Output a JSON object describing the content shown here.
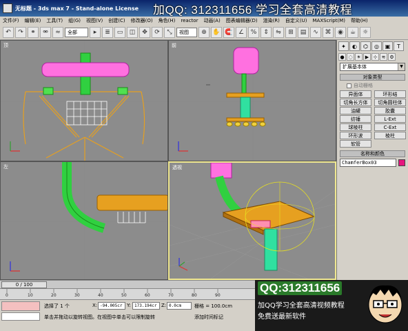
{
  "window": {
    "title": "无标题 - 3ds max 7 - Stand-alone License",
    "watermark": "加QQ: 312311656 学习全套高清教程"
  },
  "menu": [
    "文件(F)",
    "编辑(E)",
    "工具(T)",
    "组(G)",
    "视图(V)",
    "创建(C)",
    "修改器(O)",
    "角色(H)",
    "reactor",
    "动画(A)",
    "图表编辑器(D)",
    "渲染(R)",
    "自定义(U)",
    "MAXScript(M)",
    "帮助(H)"
  ],
  "toolbar": {
    "selection_filter": "全部",
    "ref_coord": "视图"
  },
  "viewports": {
    "top_left_label": "顶",
    "top_right_label": "前",
    "bottom_left_label": "左",
    "bottom_right_label": "透视"
  },
  "command_panel": {
    "category": "扩展基本体",
    "rollout_object_type": "对象类型",
    "autogrid": "自动栅格",
    "objects": [
      "异面体",
      "环形结",
      "切角长方体",
      "切角圆柱体",
      "油罐",
      "胶囊",
      "纺锤",
      "L-Ext",
      "球棱柱",
      "C-Ext",
      "环形波",
      "棱柱",
      "软管"
    ],
    "rollout_name_color": "名称和颜色",
    "object_name": "ChamferBox03",
    "object_color": "#e6147f"
  },
  "timeline": {
    "frame_display": "0 / 100",
    "ticks": [
      "0",
      "10",
      "20",
      "30",
      "40",
      "50",
      "60",
      "70",
      "80",
      "90"
    ]
  },
  "status": {
    "selection": "选择了 1 个",
    "x_label": "X:",
    "x_value": "-94.005cr",
    "y_label": "Y:",
    "y_value": "173.194cr",
    "z_label": "Z:",
    "z_value": "0.0cm",
    "grid": "栅格 = 100.0cm",
    "prompt": "单击并拖动以旋转视图。在视图中单击可以限制旋转",
    "add_time_tag": "添加时间标记"
  },
  "promo": {
    "qq": "QQ:312311656",
    "line1": "加QQ学习全套高清视频教程",
    "line2": "免费送最新软件"
  }
}
